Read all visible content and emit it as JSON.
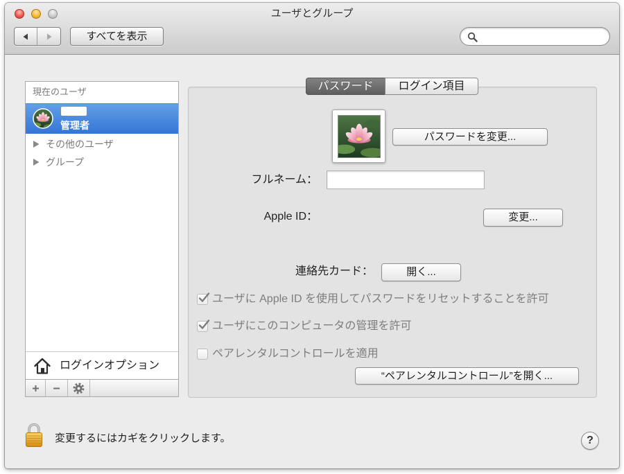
{
  "window": {
    "title": "ユーザとグループ",
    "control_icons": [
      "close-icon",
      "minimize-icon",
      "zoom-icon"
    ]
  },
  "toolbar": {
    "back_icon": "chevron-left-icon",
    "forward_icon": "chevron-right-icon",
    "show_all_label": "すべてを表示",
    "search": {
      "placeholder": "",
      "value": "",
      "icon": "search-icon"
    }
  },
  "sidebar": {
    "current_users_header": "現在のユーザ",
    "selected_user": {
      "role": "管理者",
      "avatar": "lotus-photo"
    },
    "sections": [
      {
        "label": "その他のユーザ",
        "expanded": false
      },
      {
        "label": "グループ",
        "expanded": false
      }
    ],
    "login_options_label": "ログインオプション",
    "login_options_icon": "house-icon",
    "action_icons": [
      "plus-icon",
      "minus-icon",
      "gear-icon"
    ]
  },
  "tabs": [
    {
      "label": "パスワード",
      "selected": true
    },
    {
      "label": "ログイン項目",
      "selected": false
    }
  ],
  "password_tab": {
    "picture": "lotus-photo",
    "change_password_label": "パスワードを変更...",
    "full_name": {
      "label": "フルネーム：",
      "value": ""
    },
    "apple_id": {
      "label": "Apple ID：",
      "button_label": "変更..."
    },
    "contact_card": {
      "label": "連絡先カード：",
      "button_label": "開く..."
    },
    "options": [
      {
        "label": "ユーザに Apple ID を使用してパスワードをリセットすることを許可",
        "checked": true,
        "enabled": false
      },
      {
        "label": "ユーザにこのコンピュータの管理を許可",
        "checked": true,
        "enabled": false
      },
      {
        "label": "ペアレンタルコントロールを適用",
        "checked": false,
        "enabled": false
      }
    ],
    "parental_controls_button_label": "“ペアレンタルコントロール”を開く..."
  },
  "footer": {
    "lock_icon": "lock-icon",
    "lock_message": "変更するにはカギをクリックします。",
    "help_label": "?"
  },
  "colors": {
    "selection": "#3575d5",
    "selected_tab": "#6b6b6b",
    "window_background": "#ececec",
    "disabled_text": "#7d7d7d"
  }
}
